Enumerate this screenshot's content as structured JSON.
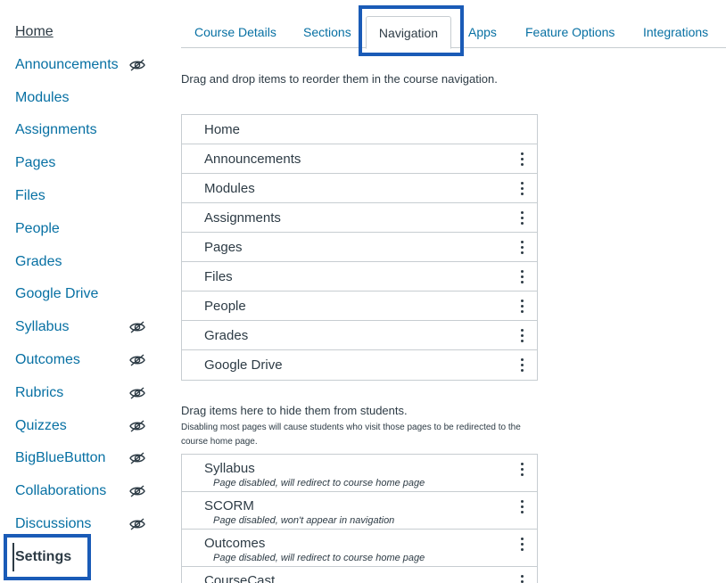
{
  "course_nav": {
    "items": [
      {
        "label": "Home",
        "hidden": false
      },
      {
        "label": "Announcements",
        "hidden": true
      },
      {
        "label": "Modules",
        "hidden": false
      },
      {
        "label": "Assignments",
        "hidden": false
      },
      {
        "label": "Pages",
        "hidden": false
      },
      {
        "label": "Files",
        "hidden": false
      },
      {
        "label": "People",
        "hidden": false
      },
      {
        "label": "Grades",
        "hidden": false
      },
      {
        "label": "Google Drive",
        "hidden": false
      },
      {
        "label": "Syllabus",
        "hidden": true
      },
      {
        "label": "Outcomes",
        "hidden": true
      },
      {
        "label": "Rubrics",
        "hidden": true
      },
      {
        "label": "Quizzes",
        "hidden": true
      },
      {
        "label": "BigBlueButton",
        "hidden": true
      },
      {
        "label": "Collaborations",
        "hidden": true
      },
      {
        "label": "Discussions",
        "hidden": true
      }
    ],
    "settings_label": "Settings"
  },
  "tabs": [
    "Course Details",
    "Sections",
    "Navigation",
    "Apps",
    "Feature Options",
    "Integrations"
  ],
  "active_tab": "Navigation",
  "instructions": "Drag and drop items to reorder them in the course navigation.",
  "enabled_items": [
    "Home",
    "Announcements",
    "Modules",
    "Assignments",
    "Pages",
    "Files",
    "People",
    "Grades",
    "Google Drive"
  ],
  "hidden_section": {
    "heading": "Drag items here to hide them from students.",
    "note": "Disabling most pages will cause students who visit those pages to be redirected to the course home page."
  },
  "disabled_items": [
    {
      "name": "Syllabus",
      "status": "Page disabled, will redirect to course home page"
    },
    {
      "name": "SCORM",
      "status": "Page disabled, won't appear in navigation"
    },
    {
      "name": "Outcomes",
      "status": "Page disabled, will redirect to course home page"
    },
    {
      "name": "CourseCast",
      "status": ""
    }
  ],
  "colors": {
    "link": "#0770a3",
    "text": "#2d3b45",
    "highlight": "#1a5bb7",
    "border": "#c7cdd1"
  }
}
